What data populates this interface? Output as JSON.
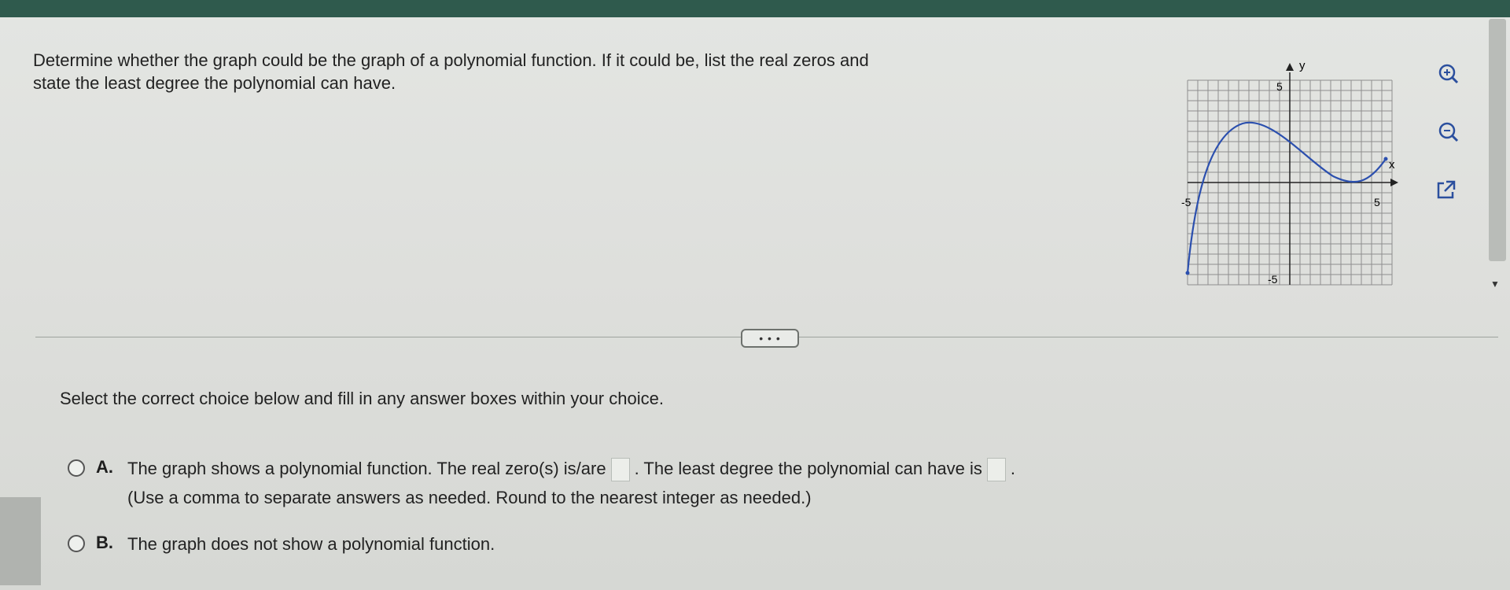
{
  "question": {
    "line1": "Determine whether the graph could be the graph of a polynomial function. If it could be, list the real zeros and",
    "line2": "state the least degree the polynomial can have."
  },
  "graph": {
    "y_label": "y",
    "x_label": "x",
    "tick_y_top": "5",
    "tick_y_bottom": "-5",
    "tick_x_left": "-5",
    "tick_x_right": "5",
    "curve_color": "#2b4fae",
    "grid_color": "#8e8e8e"
  },
  "tools": {
    "zoom_in_icon": "zoom-in-icon",
    "zoom_out_icon": "zoom-out-icon",
    "popout_icon": "external-link-icon"
  },
  "expand_label": "• • •",
  "instruction": "Select the correct choice below and fill in any answer boxes within your choice.",
  "choices": {
    "a": {
      "letter": "A.",
      "text_part1": "The graph shows a polynomial function. The real zero(s) is/are",
      "text_part2": ". The least degree the polynomial can have is",
      "text_part3": ".",
      "hint": "(Use a comma to separate answers as needed.  Round to the nearest integer as needed.)"
    },
    "b": {
      "letter": "B.",
      "text": "The graph does not show a polynomial function."
    }
  }
}
